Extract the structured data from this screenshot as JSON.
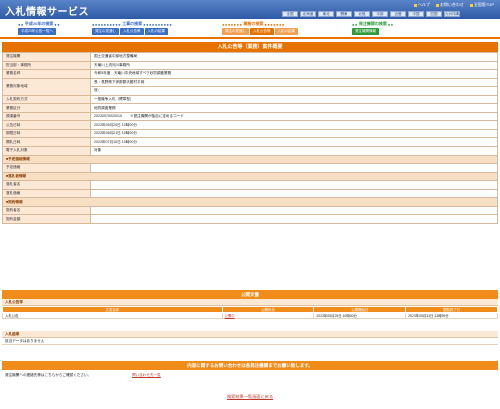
{
  "app": {
    "title": "入札情報サービス"
  },
  "toplinks": [
    {
      "label": "ヘルプ"
    },
    {
      "label": "お問い合わせ"
    },
    {
      "label": "全国版TOP"
    }
  ],
  "regions": [
    "全国",
    "北海道",
    "東北",
    "関東",
    "北陸",
    "中部",
    "近畿",
    "中国",
    "四国",
    "九州沖縄"
  ],
  "categories": [
    {
      "title": "平成20年の検索",
      "color": "#3b6fc4",
      "tabs": [
        {
          "label": "平成20年公告一覧へ",
          "color": "#3b6fc4"
        }
      ]
    },
    {
      "title": "工事の検索",
      "color": "#3b6fc4",
      "tabs": [
        {
          "label": "発注の見通し",
          "color": "#3b6fc4"
        },
        {
          "label": "入札公告等",
          "color": "#3b6fc4"
        },
        {
          "label": "入札の結果",
          "color": "#3b6fc4"
        }
      ]
    },
    {
      "title": "業務の検索",
      "color": "#e67300",
      "tabs": [
        {
          "label": "発注の見通し",
          "color": "#e67300"
        },
        {
          "label": "入札公告等",
          "color": "#e67300",
          "active": true
        },
        {
          "label": "入札の結果",
          "color": "#e67300"
        }
      ]
    },
    {
      "title": "発注機関の検索",
      "color": "#2e9a3a",
      "tabs": [
        {
          "label": "発注機関情報",
          "color": "#2e9a3a"
        }
      ]
    }
  ],
  "detail": {
    "title": "入札公告等（業務）案件概要",
    "rows": [
      {
        "label": "発注機関",
        "value": "国土交通省中部地方整備局"
      },
      {
        "label": "担当部・事務所",
        "value": "天竜川上流河川事務所"
      },
      {
        "label": "業務名称",
        "value": "令和5年度　天竜川中央地域すべり砂防調査業務"
      },
      {
        "label": "業務対象地域",
        "value": "長・長野県下伊那郡天龍村平岡",
        "value2": "冠："
      },
      {
        "label": "入札契約方式",
        "value": "一般競争入札（標準型）"
      },
      {
        "label": "業務区分",
        "value": "地質調査業務"
      },
      {
        "label": "調達番号",
        "value": "20230570020010",
        "note": "※発注機関が独自に定めるコード"
      },
      {
        "label": "公告日時",
        "value": "2023年05月25日 10時00分"
      },
      {
        "label": "期限日時",
        "value": "2023年06月21日 10時00分"
      },
      {
        "label": "開札日時",
        "value": "2023年07月10日 10時00分"
      },
      {
        "label": "電子入札対象",
        "value": "対象"
      }
    ],
    "sections": [
      {
        "title": "■予定価格情報",
        "rows": [
          {
            "label": "予定価格",
            "value": ""
          }
        ]
      },
      {
        "title": "■落札者情報",
        "rows": [
          {
            "label": "落札者名",
            "value": ""
          },
          {
            "label": "落札価格",
            "value": ""
          }
        ]
      },
      {
        "title": "■契約情報",
        "rows": [
          {
            "label": "契約者名",
            "value": ""
          },
          {
            "label": "契約金額",
            "value": ""
          }
        ]
      }
    ]
  },
  "docs": {
    "title": "公開文書",
    "sub1": "入札公告等",
    "headers": [
      "文書名称",
      "公開状況",
      "公開開始日",
      "閲覧終了日"
    ],
    "row": [
      "入札公告",
      "公開中",
      "2023年05月25日 10時00分",
      "2023年05月31日 23時59分"
    ],
    "sub2": "入札結果",
    "nodata": "該当データはありません"
  },
  "inquiry": {
    "title": "内容に関するお問い合わせは各発注機関までお願い致します。",
    "text": "発注機関への連絡先等はこちらからご確認ください。",
    "link": "問い合わせ先一覧"
  },
  "back": "検索結果一覧画面に戻る"
}
